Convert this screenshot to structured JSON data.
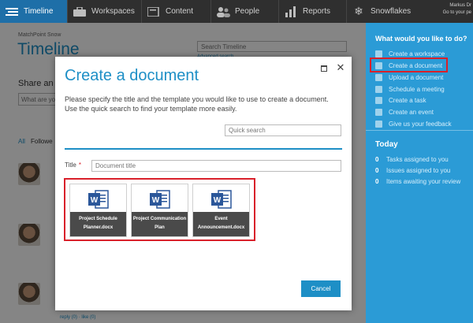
{
  "nav": {
    "items": [
      {
        "label": "Timeline",
        "icon": "timeline-icon"
      },
      {
        "label": "Workspaces",
        "icon": "briefcase-icon"
      },
      {
        "label": "Content",
        "icon": "folder-icon"
      },
      {
        "label": "People",
        "icon": "people-icon"
      },
      {
        "label": "Reports",
        "icon": "bar-chart-icon"
      },
      {
        "label": "Snowflakes",
        "icon": "snowflake-icon"
      }
    ],
    "user_name": "Markus Dr",
    "user_link": "Go to your pe"
  },
  "page": {
    "site_name": "MatchPoint Snow",
    "title": "Timeline",
    "search_placeholder": "Search Timeline",
    "advanced_search": "Advanced search",
    "share_label": "Share an up",
    "share_placeholder": "What are yo",
    "tab_all": "All",
    "tab_follow": "Followe",
    "reply_line": "reply (0)  ·  like (0)"
  },
  "sidebar": {
    "title": "What would you like to do?",
    "actions": [
      {
        "label": "Create a workspace",
        "icon": "workspace-icon"
      },
      {
        "label": "Create a document",
        "icon": "document-icon"
      },
      {
        "label": "Upload a document",
        "icon": "upload-icon"
      },
      {
        "label": "Schedule a meeting",
        "icon": "meeting-icon"
      },
      {
        "label": "Create a task",
        "icon": "flag-icon"
      },
      {
        "label": "Create an event",
        "icon": "calendar-icon"
      },
      {
        "label": "Give us your feedback",
        "icon": "feedback-icon"
      }
    ],
    "today_title": "Today",
    "today_items": [
      {
        "count": "0",
        "label": "Tasks assigned to you"
      },
      {
        "count": "0",
        "label": "Issues assigned to you"
      },
      {
        "count": "0",
        "label": "Items awaiting your review"
      }
    ]
  },
  "dialog": {
    "title": "Create a document",
    "description": "Please specify the title and the template you would like to use to create a document. Use the quick search to find your template more easily.",
    "quick_search_placeholder": "Quick search",
    "title_label": "Title",
    "required_mark": "*",
    "title_placeholder": "Document title",
    "templates": [
      {
        "name": "Project Schedule Planner.docx"
      },
      {
        "name": "Project Communication Plan"
      },
      {
        "name": "Event Announcement.docx"
      }
    ],
    "cancel_label": "Cancel"
  },
  "colors": {
    "accent": "#1e8fc6",
    "sidebar": "#2b9bd6",
    "nav_bg": "#2f2f2f",
    "highlight": "#d9202a",
    "word_blue": "#2b579a"
  }
}
